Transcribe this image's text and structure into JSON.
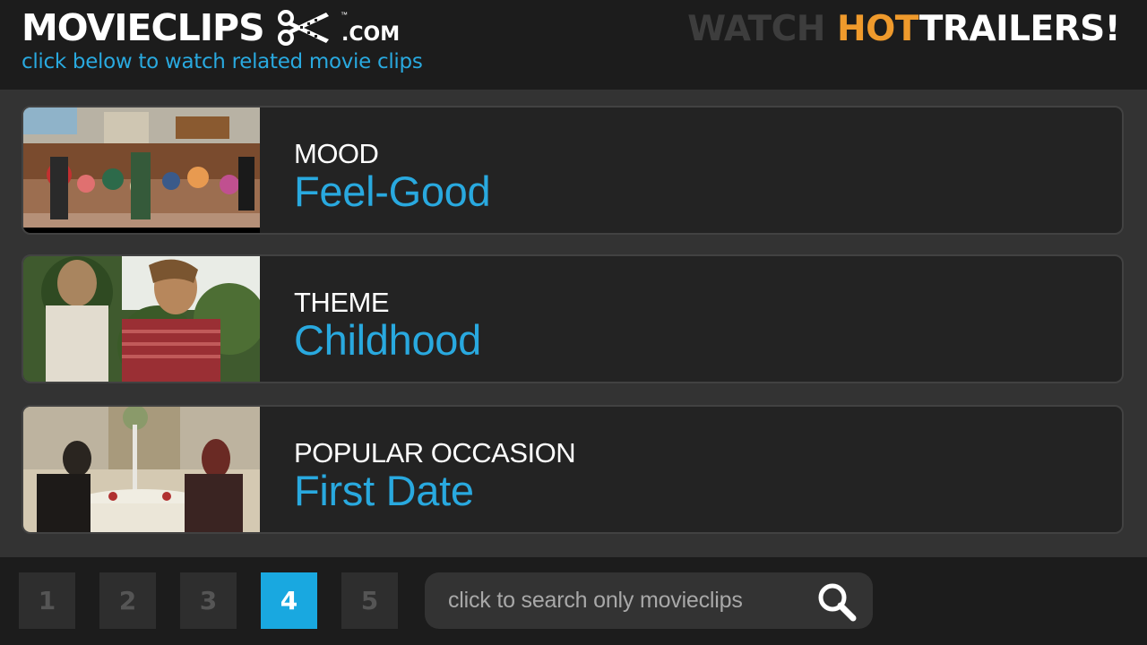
{
  "header": {
    "logo_text": "MOVIECLIPS",
    "logo_tm": "™",
    "logo_domain": ".COM",
    "tagline": "click below to watch related movie clips",
    "promo": {
      "part1": "WATCH ",
      "part2": "HOT",
      "part3": "TRAILERS!"
    }
  },
  "categories": [
    {
      "label": "MOOD",
      "value": "Feel-Good",
      "thumb": "toy-store-dance-scene"
    },
    {
      "label": "THEME",
      "value": "Childhood",
      "thumb": "two-boys-outdoors-scene"
    },
    {
      "label": "POPULAR OCCASION",
      "value": "First Date",
      "thumb": "restaurant-dinner-scene"
    }
  ],
  "pagination": {
    "pages": [
      "1",
      "2",
      "3",
      "4",
      "5"
    ],
    "current": "4"
  },
  "search": {
    "placeholder": "click to search only movieclips",
    "icon": "magnifier-icon"
  },
  "colors": {
    "accent_blue": "#29a9df",
    "active_page": "#19a8e0",
    "hot_orange": "#ef9a2c",
    "background": "#333333",
    "bar": "#1c1c1c"
  }
}
